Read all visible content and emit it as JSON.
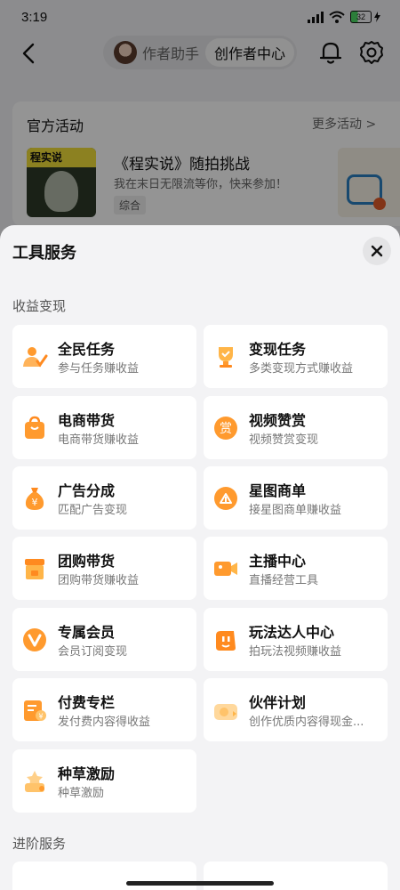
{
  "status": {
    "time": "3:19",
    "battery": "32"
  },
  "header": {
    "assistant_tab": "作者助手",
    "center_tab": "创作者中心"
  },
  "activity": {
    "section_title": "官方活动",
    "more": "更多活动 >",
    "thumb_banner": "程实说",
    "name": "《程实说》随拍挑战",
    "description": "我在末日无限流等你，快来参加！",
    "tag": "综合"
  },
  "sheet": {
    "title": "工具服务",
    "section_income": "收益变现",
    "section_advanced": "进阶服务"
  },
  "tools": [
    {
      "name": "全民任务",
      "desc": "参与任务赚收益",
      "icon": "people-task-icon"
    },
    {
      "name": "变现任务",
      "desc": "多类变现方式赚收益",
      "icon": "trophy-icon"
    },
    {
      "name": "电商带货",
      "desc": "电商带货赚收益",
      "icon": "shopping-bag-icon"
    },
    {
      "name": "视频赞赏",
      "desc": "视频赞赏变现",
      "icon": "reward-icon",
      "glyph": "赏"
    },
    {
      "name": "广告分成",
      "desc": "匹配广告变现",
      "icon": "money-bag-icon"
    },
    {
      "name": "星图商单",
      "desc": "接星图商单赚收益",
      "icon": "star-map-icon"
    },
    {
      "name": "团购带货",
      "desc": "团购带货赚收益",
      "icon": "store-icon"
    },
    {
      "name": "主播中心",
      "desc": "直播经营工具",
      "icon": "camera-icon"
    },
    {
      "name": "专属会员",
      "desc": "会员订阅变现",
      "icon": "vip-badge-icon"
    },
    {
      "name": "玩法达人中心",
      "desc": "拍玩法视频赚收益",
      "icon": "play-expert-icon"
    },
    {
      "name": "付费专栏",
      "desc": "发付费内容得收益",
      "icon": "paid-column-icon"
    },
    {
      "name": "伙伴计划",
      "desc": "创作优质内容得现金...",
      "icon": "partner-icon"
    },
    {
      "name": "种草激励",
      "desc": "种草激励",
      "icon": "seeding-icon"
    }
  ],
  "colors": {
    "accent": "#ff8a1f",
    "accent_light": "#ffc36a"
  }
}
